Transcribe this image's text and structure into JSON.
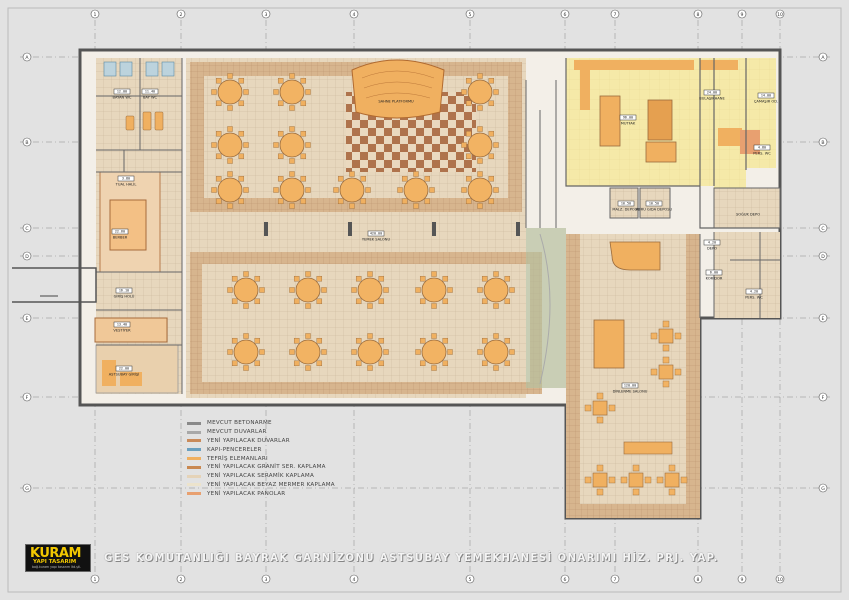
{
  "title": "GES KOMUTANLIĞI BAYRAK GARNİZONU ASTSUBAY YEMEKHANESİ ONARIMI HİZ. PRJ. YAP.",
  "logo": {
    "mark": "KURAM",
    "subtitle": "YAPI TASARIM",
    "tagline": "bağ.kuram yapı tasarım ltd.şti."
  },
  "legend": [
    {
      "label": "MEVCUT BETONARME",
      "color": "#8a8a8a"
    },
    {
      "label": "MEVCUT DUVARLAR",
      "color": "#a8a8a8"
    },
    {
      "label": "YENİ YAPILACAK DUVARLAR",
      "color": "#c98a5a"
    },
    {
      "label": "KAPI-PENCERELER",
      "color": "#6aa0c0"
    },
    {
      "label": "TEFRİŞ ELEMANLARI",
      "color": "#f0b060"
    },
    {
      "label": "YENİ YAPILACAK GRANİT SER. KAPLAMA",
      "color": "#c98850"
    },
    {
      "label": "YENİ YAPILACAK SERAMİK KAPLAMA",
      "color": "#e5d3b8"
    },
    {
      "label": "YENİ YAPILACAK BEYAZ MERMER KAPLAMA",
      "color": "#ece3cc"
    },
    {
      "label": "YENİ YAPILACAK PANOLAR",
      "color": "#e8a070"
    }
  ],
  "grid": {
    "columns": [
      "1",
      "2",
      "3",
      "4",
      "5",
      "6",
      "7",
      "8",
      "9",
      "10"
    ],
    "rows": [
      "A",
      "B",
      "C",
      "D",
      "E",
      "F",
      "G"
    ]
  },
  "rooms": [
    {
      "name": "BAYAN WC",
      "area": "12.00"
    },
    {
      "name": "BAY WC",
      "area": "11.40"
    },
    {
      "name": "TUAL HALİL",
      "area": "3.80"
    },
    {
      "name": "BERBER",
      "area": "22.60"
    },
    {
      "name": "GİRİŞ HOLÜ",
      "area": "16.10"
    },
    {
      "name": "VESTİYER",
      "area": "13.40"
    },
    {
      "name": "ASTSUBAY GİRİŞİ",
      "area": "22.00"
    },
    {
      "name": "YEMEK SALONU",
      "area": "420.00"
    },
    {
      "name": "SAHNE PLATFORMU",
      "area": ""
    },
    {
      "name": "MUTFAK",
      "area": "96.00"
    },
    {
      "name": "BULAŞIKHANE",
      "area": "24.00"
    },
    {
      "name": "ÇAMAŞIR OD.",
      "area": "14.00"
    },
    {
      "name": "PERS. WC",
      "area": "4.80"
    },
    {
      "name": "MALZ. DEPOSU",
      "area": "10.50"
    },
    {
      "name": "KURU GIDA DEPOSU",
      "area": "10.50"
    },
    {
      "name": "SOĞUK DEPO",
      "area": ""
    },
    {
      "name": "DEPO",
      "area": "4.20"
    },
    {
      "name": "KORİDOR",
      "area": "6.00"
    },
    {
      "name": "PERS. WC",
      "area": "4.20"
    },
    {
      "name": "DİNLENME SALONU",
      "area": "120.00"
    }
  ]
}
